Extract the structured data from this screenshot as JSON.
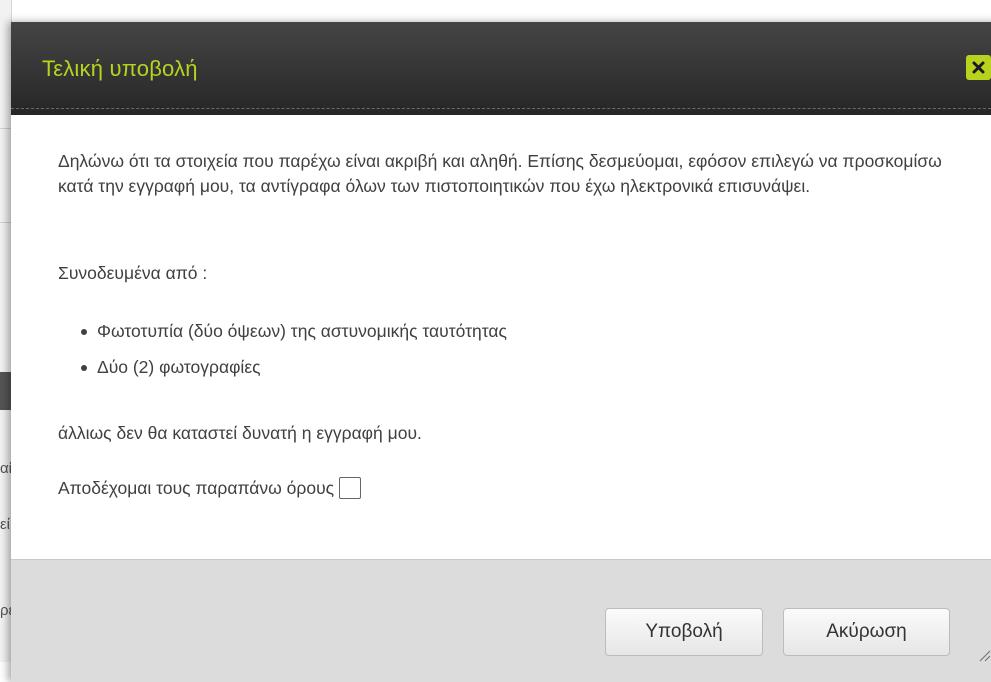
{
  "background": {
    "fragments": [
      "αί",
      "εί",
      "ρέ"
    ]
  },
  "dialog": {
    "title": "Τελική υποβολή",
    "close_icon": "close-x-icon",
    "accent_color": "#b9d21e",
    "paragraph_1": "Δηλώνω ότι τα στοιχεία που παρέχω είναι ακριβή και αληθή. Επίσης δεσμεύομαι, εφόσον επιλεγώ να προσκομίσω κατά την εγγραφή μου, τα αντίγραφα όλων των πιστοποιητικών που έχω ηλεκτρονικά επισυνάψει.",
    "paragraph_2": "Συνοδευμένα από :",
    "bullets": [
      "Φωτοτυπία (δύο όψεων) της αστυνομικής ταυτότητας",
      "Δύο (2) φωτογραφίες"
    ],
    "paragraph_3": "άλλιως δεν θα καταστεί δυνατή η εγγραφή μου.",
    "accept_label": "Αποδέχομαι τους παραπάνω όρους",
    "accept_checked": false,
    "buttons": {
      "submit": "Υποβολή",
      "cancel": "Ακύρωση"
    }
  }
}
